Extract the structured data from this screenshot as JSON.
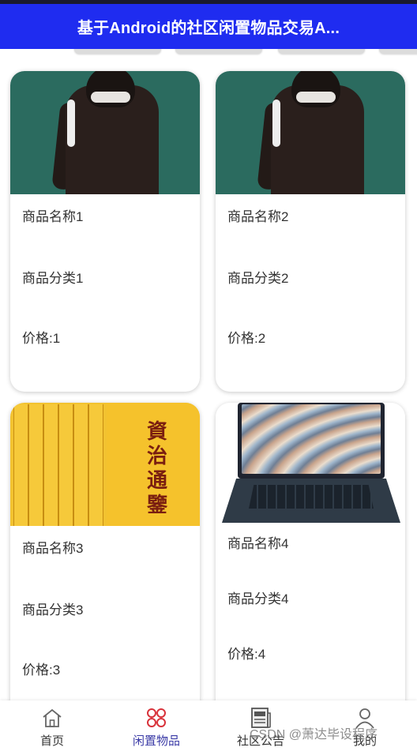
{
  "header": {
    "title": "基于Android的社区闲置物品交易A..."
  },
  "products": [
    {
      "name": "商品名称1",
      "category": "商品分类1",
      "price": "价格:1"
    },
    {
      "name": "商品名称2",
      "category": "商品分类2",
      "price": "价格:2"
    },
    {
      "name": "商品名称3",
      "category": "商品分类3",
      "price": "价格:3"
    },
    {
      "name": "商品名称4",
      "category": "商品分类4",
      "price": "价格:4"
    }
  ],
  "book_cover_title": "資治通鑒",
  "bottom_nav": {
    "items": [
      {
        "label": "首页",
        "icon": "home-icon"
      },
      {
        "label": "闲置物品",
        "icon": "grid-icon",
        "active": true
      },
      {
        "label": "社区公告",
        "icon": "newspaper-icon"
      },
      {
        "label": "我的",
        "icon": "user-icon"
      }
    ]
  },
  "watermark": "CSDN @萧达毕设程序",
  "colors": {
    "header_bg": "#1f2cf0",
    "active_nav": "#3a3aa6",
    "active_icon": "#d8323a"
  }
}
